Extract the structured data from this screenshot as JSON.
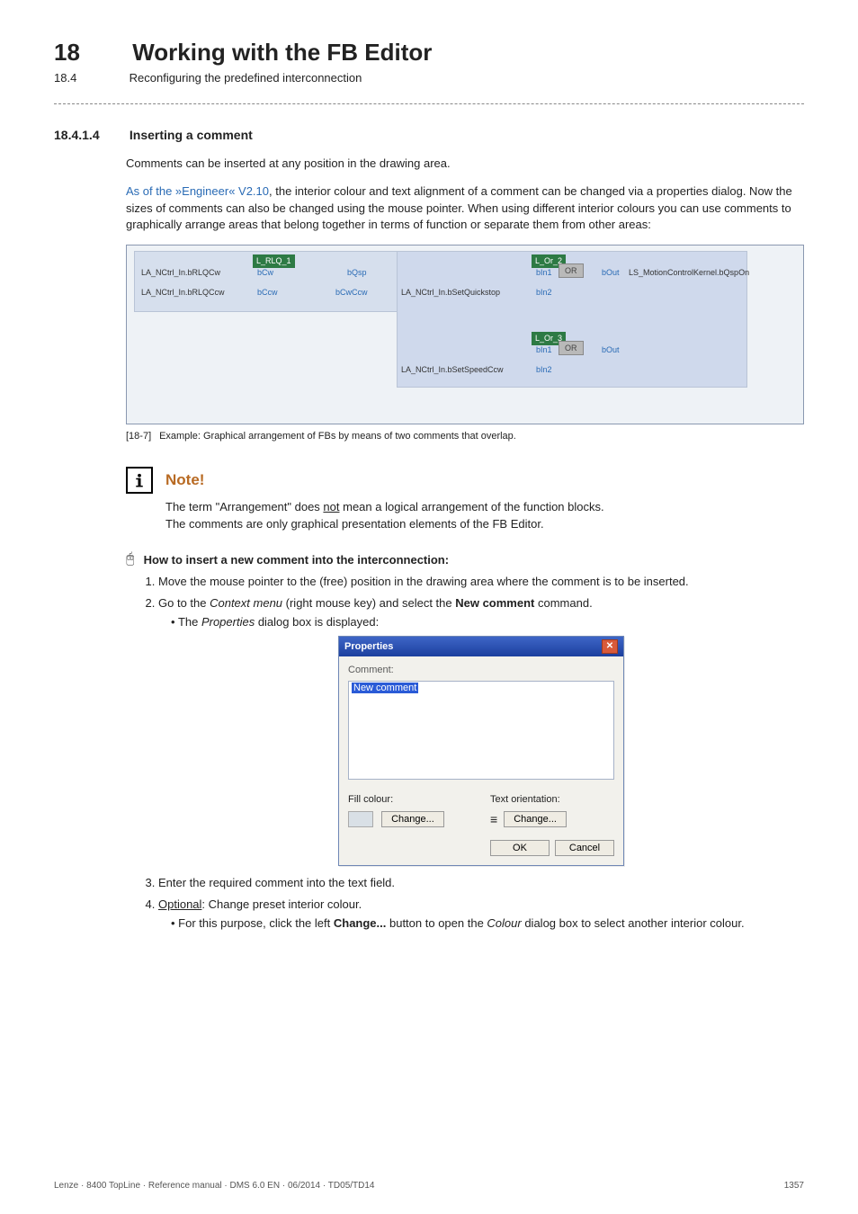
{
  "header": {
    "chapter_number": "18",
    "chapter_title": "Working with the FB Editor",
    "section_number": "18.4",
    "section_title": "Reconfiguring the predefined interconnection"
  },
  "section": {
    "number": "18.4.1.4",
    "title": "Inserting a comment",
    "intro": "Comments can be inserted at any position in the drawing area.",
    "version_lead": "As of the »Engineer« V2.10",
    "version_rest": ", the interior colour and text alignment of a comment can be changed via a properties dialog. Now the sizes of comments can also be changed using the mouse pointer. When using different interior colours you can use comments to graphically arrange areas that belong together in terms of function or separate them from other areas:"
  },
  "figure": {
    "tag": "[18-7]",
    "caption": "Example: Graphical arrangement of FBs by means of two comments that overlap.",
    "labels": {
      "rlq_block": "L_RLQ_1",
      "la_rlqcw": "LA_NCtrl_In.bRLQCw",
      "la_rlqccw": "LA_NCtrl_In.bRLQCcw",
      "bcw": "bCw",
      "bccw": "bCcw",
      "bqsp": "bQsp",
      "bcwccw": "bCwCcw",
      "la_setqs": "LA_NCtrl_In.bSetQuickstop",
      "la_setspd": "LA_NCtrl_In.bSetSpeedCcw",
      "or2": "L_Or_2",
      "or3": "L_Or_3",
      "or_body": "OR",
      "bin1": "bIn1",
      "bin2": "bIn2",
      "bout": "bOut",
      "ls_out": "LS_MotionControlKernel.bQspOn"
    }
  },
  "note": {
    "title": "Note!",
    "line1_prefix": "The term \"Arrangement\" does ",
    "line1_not": "not",
    "line1_suffix": " mean a logical arrangement of the function blocks.",
    "line2": "The comments are only graphical presentation elements of the FB Editor."
  },
  "howto": {
    "title": "How to insert a new comment into the interconnection:",
    "steps": {
      "s1": "Move the mouse pointer to the (free) position in the drawing area where the comment is to be inserted.",
      "s2_prefix": "Go to the ",
      "s2_context": "Context menu",
      "s2_mid": " (right mouse key) and select the ",
      "s2_newcmd": "New comment",
      "s2_suffix": " command.",
      "s2_sub_prefix": "The ",
      "s2_sub_properties": "Properties",
      "s2_sub_suffix": " dialog box is displayed:",
      "s3": "Enter the required comment into the text field.",
      "s4_label": "Optional",
      "s4_rest": ": Change preset interior colour.",
      "s4_sub_prefix": "For this purpose, click the left ",
      "s4_sub_change": "Change...",
      "s4_sub_mid": " button to open the ",
      "s4_sub_colour": "Colour",
      "s4_sub_suffix": " dialog box to select another interior colour."
    }
  },
  "dialog": {
    "title": "Properties",
    "comment_label": "Comment:",
    "comment_value": "New comment",
    "fill_label": "Fill colour:",
    "orient_label": "Text orientation:",
    "change_btn": "Change...",
    "ok_btn": "OK",
    "cancel_btn": "Cancel"
  },
  "footer": {
    "left": "Lenze · 8400 TopLine · Reference manual · DMS 6.0 EN · 06/2014 · TD05/TD14",
    "page": "1357"
  }
}
